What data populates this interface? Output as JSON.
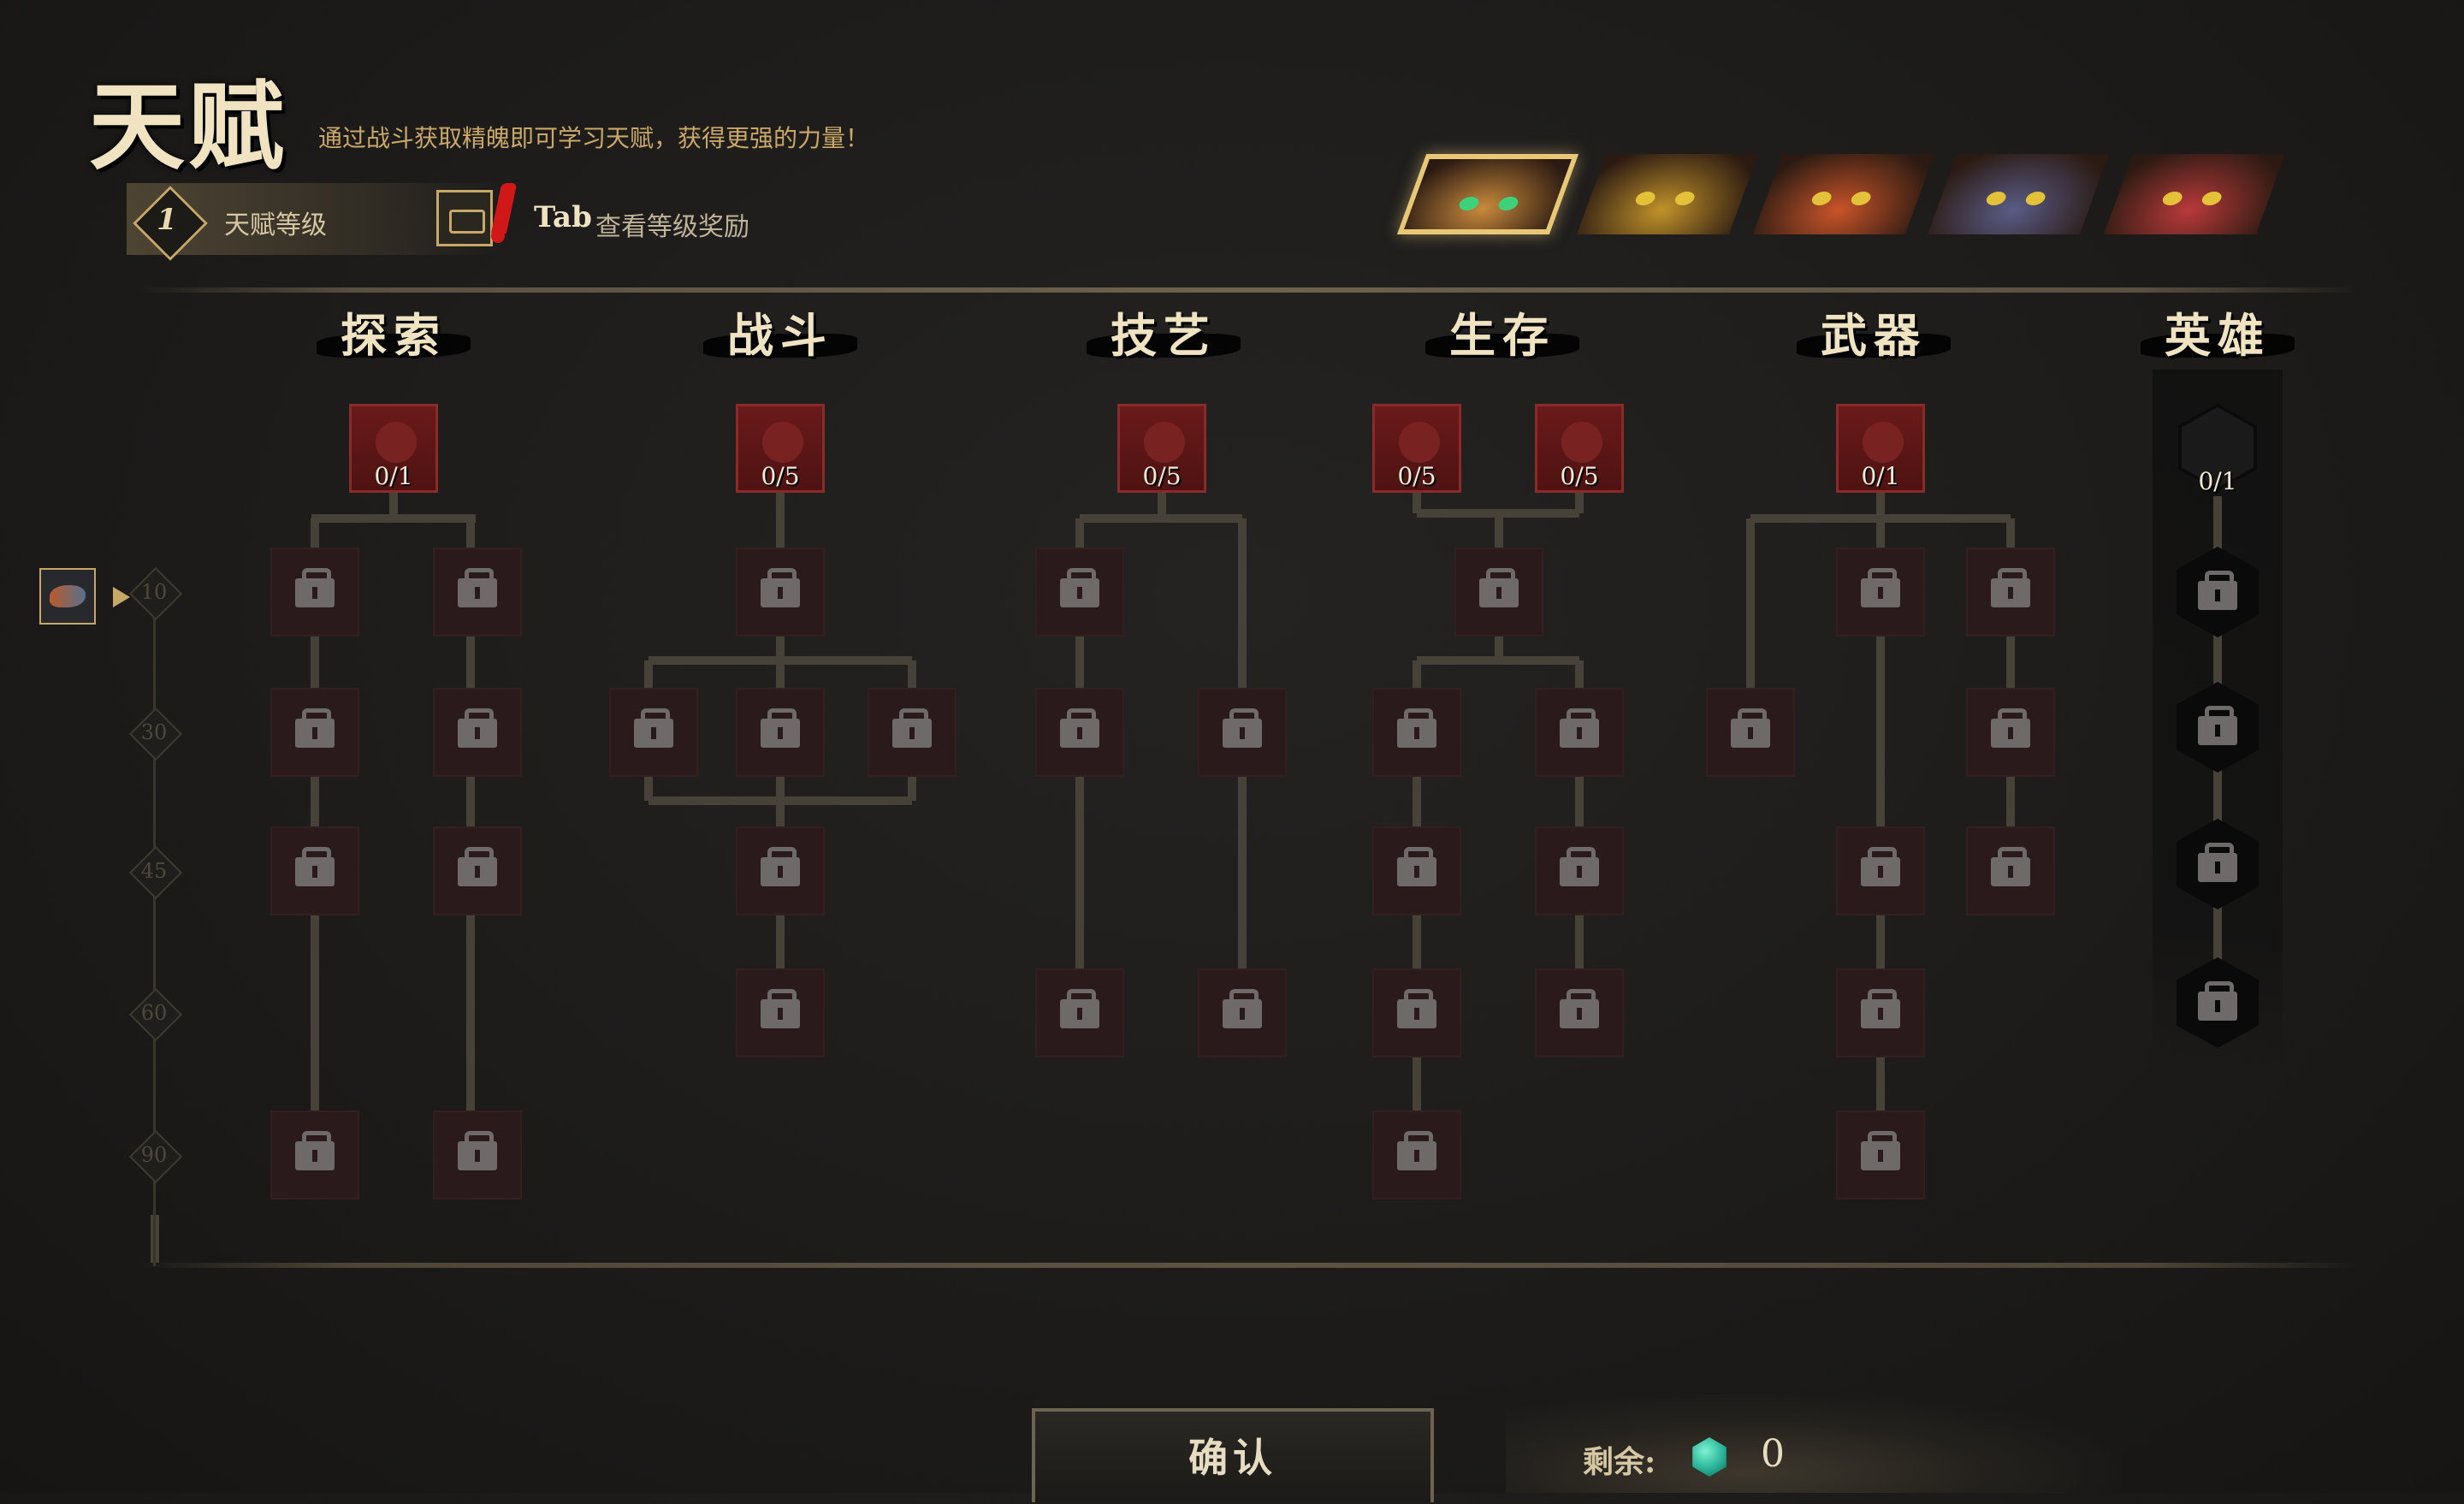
{
  "header": {
    "title": "天赋",
    "subtitle": "通过战斗获取精魄即可学习天赋，获得更强的力量！",
    "talent_level_value": "1",
    "talent_level_label": "天赋等级",
    "tab_key": "Tab",
    "tab_text": "查看等级奖励"
  },
  "heroes": [
    {
      "name": "hero-portrait-cat",
      "color": "#c98a3c",
      "active": true
    },
    {
      "name": "hero-portrait-tiger",
      "color": "#c0922a",
      "active": false
    },
    {
      "name": "hero-portrait-fox",
      "color": "#c8542a",
      "active": false
    },
    {
      "name": "hero-portrait-wolf",
      "color": "#5a5c86",
      "active": false
    },
    {
      "name": "hero-portrait-redpanda",
      "color": "#b83a3a",
      "active": false
    }
  ],
  "categories": [
    {
      "key": "explore",
      "label": "探索"
    },
    {
      "key": "combat",
      "label": "战斗"
    },
    {
      "key": "craft",
      "label": "技艺"
    },
    {
      "key": "survival",
      "label": "生存"
    },
    {
      "key": "weapon",
      "label": "武器"
    },
    {
      "key": "hero",
      "label": "英雄"
    }
  ],
  "root_nodes": [
    {
      "category": "explore",
      "icon": "swirl-icon",
      "count": "0/1"
    },
    {
      "category": "combat",
      "icon": "sword-icon",
      "count": "0/5"
    },
    {
      "category": "craft",
      "icon": "flame-icon",
      "count": "0/5"
    },
    {
      "category": "survival",
      "icon": "medical-cross-icon",
      "count": "0/5"
    },
    {
      "category": "survival",
      "icon": "shield-icon",
      "count": "0/5"
    },
    {
      "category": "weapon",
      "icon": "target-icon",
      "count": "0/1"
    },
    {
      "category": "hero",
      "icon": "hero-emblem-icon",
      "count": "0/1"
    }
  ],
  "level_markers": [
    "10",
    "30",
    "45",
    "60",
    "90"
  ],
  "footer": {
    "confirm_label": "确认",
    "remaining_label": "剩余:",
    "remaining_value": "0",
    "accent_gold": "#c6a966",
    "node_red": "#6a1a1a"
  }
}
